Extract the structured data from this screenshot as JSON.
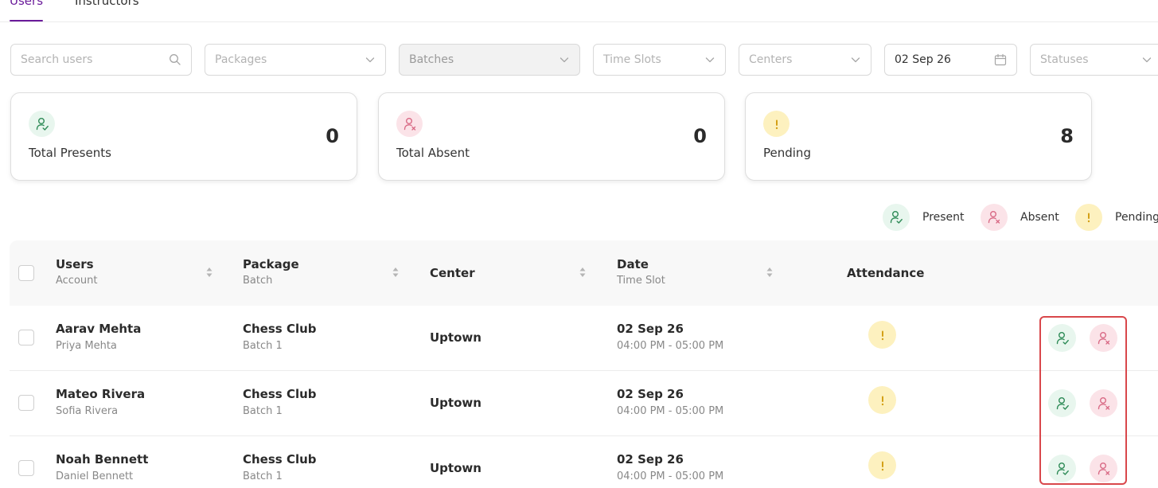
{
  "tabs": [
    {
      "label": "Users",
      "active": true
    },
    {
      "label": "Instructors",
      "active": false
    }
  ],
  "filters": {
    "search_placeholder": "Search users",
    "packages": "Packages",
    "batches": "Batches",
    "time_slots": "Time Slots",
    "centers": "Centers",
    "date": "02 Sep 26",
    "statuses": "Statuses"
  },
  "summary": {
    "presents": {
      "label": "Total Presents",
      "value": "0"
    },
    "absent": {
      "label": "Total Absent",
      "value": "0"
    },
    "pending": {
      "label": "Pending",
      "value": "8"
    }
  },
  "legend": {
    "present": "Present",
    "absent": "Absent",
    "pending": "Pending"
  },
  "table": {
    "headers": {
      "users": "Users",
      "account": "Account",
      "package": "Package",
      "batch": "Batch",
      "center": "Center",
      "date": "Date",
      "time_slot": "Time Slot",
      "attendance": "Attendance"
    },
    "rows": [
      {
        "user": "Aarav Mehta",
        "account": "Priya Mehta",
        "package": "Chess Club",
        "batch": "Batch 1",
        "center": "Uptown",
        "date": "02 Sep 26",
        "time": "04:00 PM - 05:00 PM"
      },
      {
        "user": "Mateo Rivera",
        "account": "Sofia Rivera",
        "package": "Chess Club",
        "batch": "Batch 1",
        "center": "Uptown",
        "date": "02 Sep 26",
        "time": "04:00 PM - 05:00 PM"
      },
      {
        "user": "Noah Bennett",
        "account": "Daniel Bennett",
        "package": "Chess Club",
        "batch": "Batch 1",
        "center": "Uptown",
        "date": "02 Sep 26",
        "time": "04:00 PM - 05:00 PM"
      }
    ]
  },
  "colors": {
    "accent": "#6a1b9a",
    "present": "#2e8b57",
    "absent": "#d96b86",
    "pending": "#d4a017",
    "highlight": "#d9474b"
  }
}
